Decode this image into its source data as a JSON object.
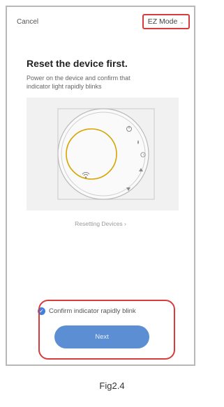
{
  "header": {
    "cancel_label": "Cancel",
    "mode_label": "EZ Mode",
    "mode_icon": "chevron-down-icon"
  },
  "main": {
    "title": "Reset the device first.",
    "subtitle": "Power on the device and confirm that indicator light rapidly blinks",
    "resetting_link": "Resetting Devices",
    "confirm_label": "Confirm indicator rapidly blink",
    "confirm_checked": true,
    "next_label": "Next"
  },
  "caption": "Fig2.4",
  "colors": {
    "annotation_red": "#d73b3b",
    "accent_blue": "#5b8ed3",
    "check_blue": "#3f7fe0",
    "device_ring": "#d6a400"
  }
}
